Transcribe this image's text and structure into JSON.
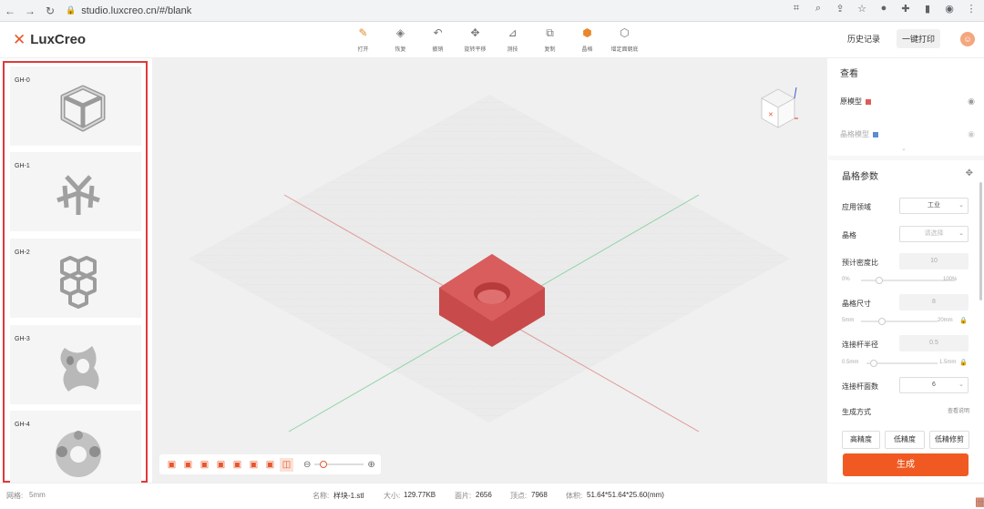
{
  "browser": {
    "back_icon": "arrow-left-icon",
    "url": "studio.luxcreo.cn/#/blank"
  },
  "app": {
    "logo_text": "LuxCreo",
    "brand_color": "#e8562b"
  },
  "toolbar": {
    "tools": [
      {
        "label": "打开",
        "icon": "open-icon"
      },
      {
        "label": "恢复",
        "icon": "restore-icon"
      },
      {
        "label": "撤销",
        "icon": "undo-icon"
      },
      {
        "label": "旋转平移",
        "icon": "transform-icon"
      },
      {
        "label": "测技",
        "icon": "measure-icon"
      },
      {
        "label": "复制",
        "icon": "copy-icon"
      },
      {
        "label": "晶格",
        "icon": "lattice-icon"
      },
      {
        "label": "增定面朝底",
        "icon": "face-down-icon"
      }
    ],
    "history_label": "历史记录",
    "print_label": "一键打印"
  },
  "lattice_library": {
    "items": [
      {
        "label": "GH-0"
      },
      {
        "label": "GH-1"
      },
      {
        "label": "GH-2"
      },
      {
        "label": "GH-3"
      },
      {
        "label": "GH-4"
      }
    ]
  },
  "viewport": {
    "model_color": "#d64545"
  },
  "view_panel": {
    "title": "查看",
    "items": [
      {
        "label": "原模型",
        "color": "#e05a5a"
      },
      {
        "label": "晶格模型",
        "color": "#5b8bd6"
      }
    ]
  },
  "params": {
    "title": "晶格参数",
    "field_domain_label": "应用领域",
    "field_domain_value": "工业",
    "field_lattice_label": "晶格",
    "field_lattice_placeholder": "请选择",
    "field_density_label": "预计密度比",
    "field_density_value": "10",
    "field_density_min": "0%",
    "field_density_max": "100%",
    "field_size_label": "晶格尺寸",
    "field_size_value": "8",
    "field_size_min": "5mm",
    "field_size_max": "20mm",
    "field_radius_label": "连接杆半径",
    "field_radius_value": "0.5",
    "field_radius_min": "0.5mm",
    "field_radius_max": "1.5mm",
    "field_faces_label": "连接杆面数",
    "field_faces_value": "6",
    "gen_mode_label": "生成方式",
    "help_label": "查看说明",
    "modes": [
      "高精度",
      "低精度",
      "低精修剪"
    ],
    "generate_label": "生成"
  },
  "status": {
    "grid_label": "网格:",
    "grid_value": "5mm",
    "name_label": "名称:",
    "name_value": "样块-1.stl",
    "size_label": "大小:",
    "size_value": "129.77KB",
    "faces_label": "面片:",
    "faces_value": "2656",
    "vertices_label": "顶点:",
    "vertices_value": "7968",
    "volume_label": "体积:",
    "volume_value": "51.64*51.64*25.60(mm)"
  }
}
